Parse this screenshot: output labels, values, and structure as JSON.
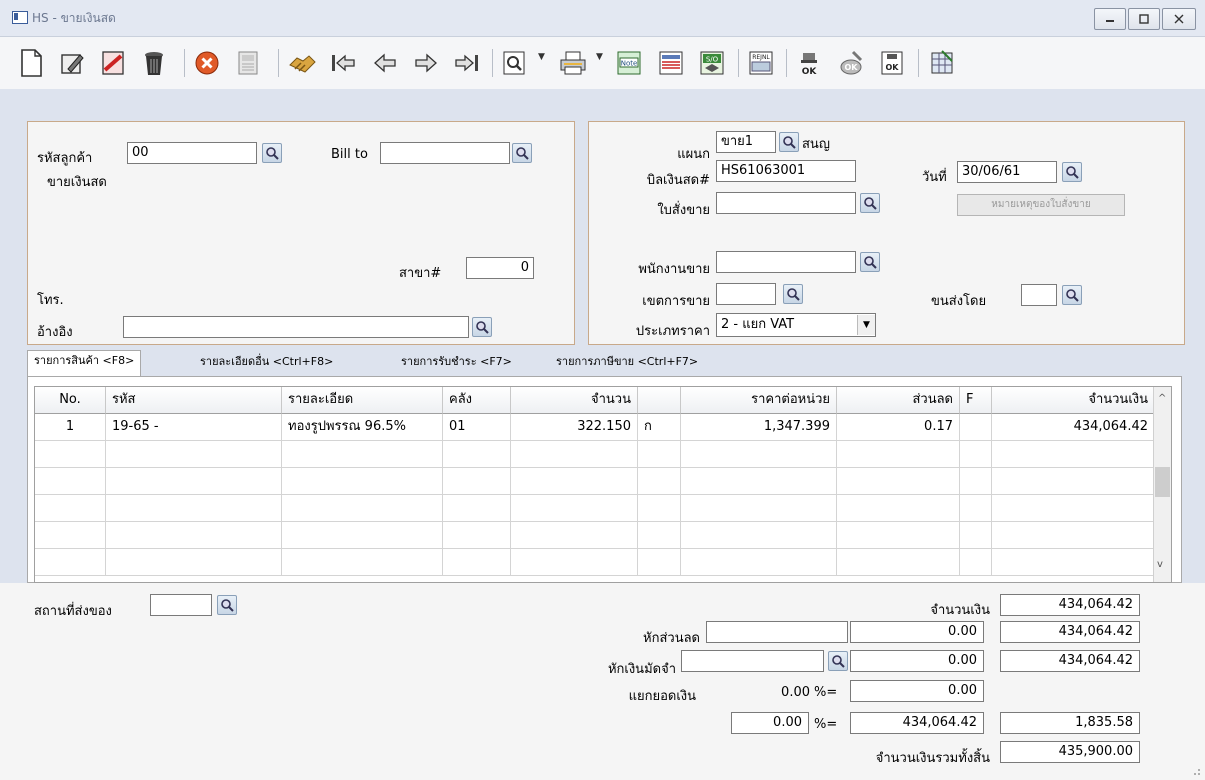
{
  "window": {
    "title": "HS - ขายเงินสด"
  },
  "customer": {
    "code_label": "รหัสลูกค้า",
    "code_value": "00",
    "name": "ขายเงินสด",
    "billto_label": "Bill to",
    "billto_value": "",
    "branch_label": "สาขา#",
    "branch_value": "0",
    "phone_label": "โทร.",
    "ref_label": "อ้างอิง",
    "ref_value": ""
  },
  "doc": {
    "dept_label": "แผนก",
    "dept_value": "ขาย1",
    "dept_name": "สนญ",
    "bill_label": "บิลเงินสด#",
    "bill_value": "HS61063001",
    "date_label": "วันที่",
    "date_value": "30/06/61",
    "order_label": "ใบสั่งขาย",
    "order_value": "",
    "order_note_button": "หมายเหตุของใบสั่งขาย",
    "salesman_label": "พนักงานขาย",
    "salesman_value": "",
    "zone_label": "เขตการขาย",
    "zone_value": "",
    "ship_label": "ขนส่งโดย",
    "ship_value": "",
    "pricetype_label": "ประเภทราคา",
    "pricetype_value": "2 - แยก VAT"
  },
  "tabs": [
    {
      "label": "รายการสินค้า <F8>"
    },
    {
      "label": "รายละเอียดอื่น <Ctrl+F8>"
    },
    {
      "label": "รายการรับชำระ <F7>"
    },
    {
      "label": "รายการภาษีขาย <Ctrl+F7>"
    }
  ],
  "grid": {
    "headers": [
      "No.",
      "รหัส",
      "รายละเอียด",
      "คลัง",
      "จำนวน",
      "",
      "ราคาต่อหน่วย",
      "ส่วนลด",
      "F",
      "จำนวนเงิน"
    ],
    "rows": [
      [
        "1",
        "19-65 -",
        "ทองรูปพรรณ 96.5%",
        "01",
        "322.150",
        "ก",
        "1,347.399",
        "0.17",
        "",
        "434,064.42"
      ]
    ]
  },
  "footer": {
    "ship_place_label": "สถานที่ส่งของ",
    "ship_place_value": "",
    "amount_label": "จำนวนเงิน",
    "amount_value": "434,064.42",
    "discount_label": "หักส่วนลด",
    "discount_input": "",
    "discount_value": "0.00",
    "discount_total": "434,064.42",
    "deposit_label": "หักเงินมัดจำ",
    "deposit_input": "",
    "deposit_value": "0.00",
    "deposit_total": "434,064.42",
    "split_label": "แยกยอดเงิน",
    "split_pct": "0.00",
    "pct_eq": "%=",
    "split_value": "0.00",
    "vat_pct": "0.00",
    "vat_base": "434,064.42",
    "vat_value": "1,835.58",
    "grand_label": "จำนวนเงินรวมทั้งสิ้น",
    "grand_value": "435,900.00"
  }
}
